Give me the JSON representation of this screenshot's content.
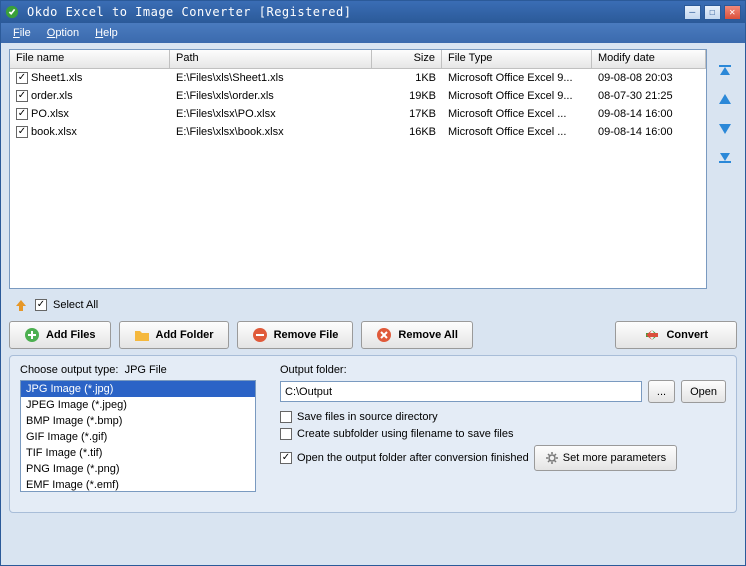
{
  "window": {
    "title": "Okdo Excel to Image Converter [Registered]"
  },
  "menu": {
    "file": "File",
    "option": "Option",
    "help": "Help"
  },
  "table": {
    "headers": {
      "name": "File name",
      "path": "Path",
      "size": "Size",
      "type": "File Type",
      "date": "Modify date"
    },
    "rows": [
      {
        "checked": true,
        "name": "Sheet1.xls",
        "path": "E:\\Files\\xls\\Sheet1.xls",
        "size": "1KB",
        "type": "Microsoft Office Excel 9...",
        "date": "09-08-08 20:03"
      },
      {
        "checked": true,
        "name": "order.xls",
        "path": "E:\\Files\\xls\\order.xls",
        "size": "19KB",
        "type": "Microsoft Office Excel 9...",
        "date": "08-07-30 21:25"
      },
      {
        "checked": true,
        "name": "PO.xlsx",
        "path": "E:\\Files\\xlsx\\PO.xlsx",
        "size": "17KB",
        "type": "Microsoft Office Excel ...",
        "date": "09-08-14 16:00"
      },
      {
        "checked": true,
        "name": "book.xlsx",
        "path": "E:\\Files\\xlsx\\book.xlsx",
        "size": "16KB",
        "type": "Microsoft Office Excel ...",
        "date": "09-08-14 16:00"
      }
    ]
  },
  "selectAll": {
    "label": "Select All",
    "checked": true
  },
  "buttons": {
    "addFiles": "Add Files",
    "addFolder": "Add Folder",
    "removeFile": "Remove File",
    "removeAll": "Remove All",
    "convert": "Convert"
  },
  "outputType": {
    "label": "Choose output type:",
    "current": "JPG File",
    "options": [
      "JPG Image (*.jpg)",
      "JPEG Image (*.jpeg)",
      "BMP Image (*.bmp)",
      "GIF Image (*.gif)",
      "TIF Image (*.tif)",
      "PNG Image (*.png)",
      "EMF Image (*.emf)"
    ],
    "selectedIndex": 0
  },
  "outputFolder": {
    "label": "Output folder:",
    "value": "C:\\Output",
    "browse": "...",
    "open": "Open"
  },
  "options": {
    "saveInSource": {
      "label": "Save files in source directory",
      "checked": false
    },
    "createSubfolder": {
      "label": "Create subfolder using filename to save files",
      "checked": false
    },
    "openAfter": {
      "label": "Open the output folder after conversion finished",
      "checked": true
    }
  },
  "setMore": "Set more parameters"
}
